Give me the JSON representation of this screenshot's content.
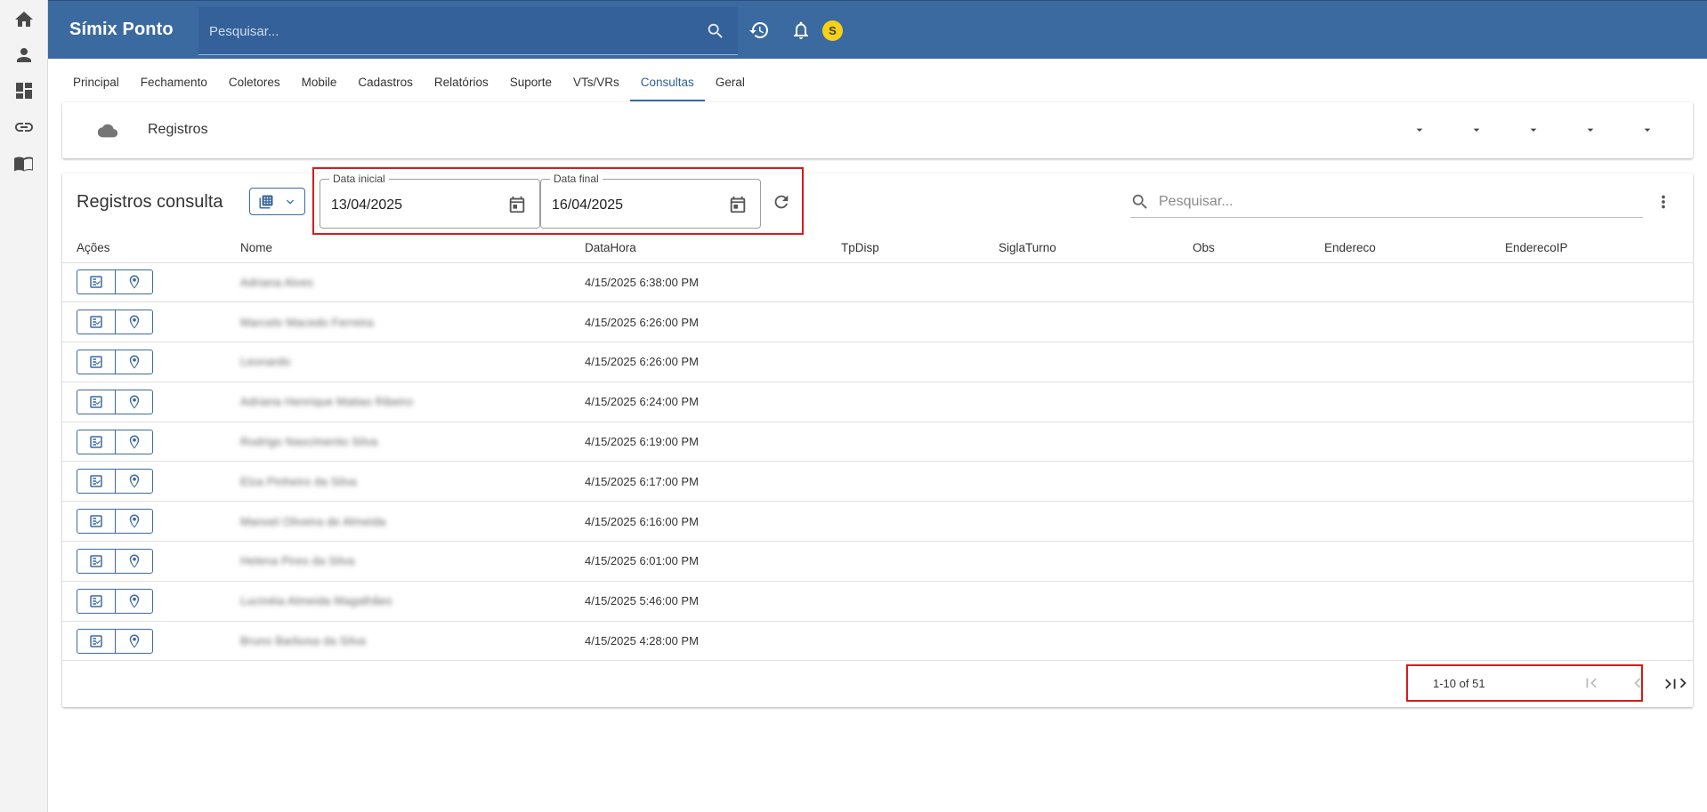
{
  "icons": {
    "rail": [
      "home-icon",
      "person-icon",
      "dashboard-icon",
      "link-icon",
      "book-icon"
    ],
    "bar": [
      "search-icon",
      "history-icon",
      "bell-icon"
    ]
  },
  "colors": {
    "primary": "#3b6aa0",
    "highlight": "#d81b1b",
    "avatar": "#f7d116"
  },
  "appbar": {
    "brand": "Símix Ponto",
    "search_placeholder": "Pesquisar...",
    "avatar_initial": "S"
  },
  "tabs": [
    {
      "label": "Principal"
    },
    {
      "label": "Fechamento"
    },
    {
      "label": "Coletores"
    },
    {
      "label": "Mobile"
    },
    {
      "label": "Cadastros"
    },
    {
      "label": "Relatórios"
    },
    {
      "label": "Suporte"
    },
    {
      "label": "VTs/VRs"
    },
    {
      "label": "Consultas",
      "active": true
    },
    {
      "label": "Geral"
    }
  ],
  "panel": {
    "title": "Registros"
  },
  "main": {
    "title": "Registros consulta",
    "date_start": {
      "label": "Data inicial",
      "value": "13/04/2025"
    },
    "date_end": {
      "label": "Data final",
      "value": "16/04/2025"
    },
    "search_placeholder": "Pesquisar..."
  },
  "table": {
    "columns": [
      "Ações",
      "Nome",
      "DataHora",
      "TpDisp",
      "SiglaTurno",
      "Obs",
      "Endereco",
      "EnderecoIP"
    ],
    "rows": [
      {
        "nome": "Adriana Alves",
        "datahora": "4/15/2025 6:38:00 PM"
      },
      {
        "nome": "Marcelo Macedo Ferreira",
        "datahora": "4/15/2025 6:26:00 PM"
      },
      {
        "nome": "Leonardo",
        "datahora": "4/15/2025 6:26:00 PM"
      },
      {
        "nome": "Adriana Henrique Matias Ribeiro",
        "datahora": "4/15/2025 6:24:00 PM"
      },
      {
        "nome": "Rodrigo Nascimento Silva",
        "datahora": "4/15/2025 6:19:00 PM"
      },
      {
        "nome": "Elza Pinheiro da Silva",
        "datahora": "4/15/2025 6:17:00 PM"
      },
      {
        "nome": "Manoel Oliveira de Almeida",
        "datahora": "4/15/2025 6:16:00 PM"
      },
      {
        "nome": "Helena Pires da Silva",
        "datahora": "4/15/2025 6:01:00 PM"
      },
      {
        "nome": "Lucinéia Almeida Magalhães",
        "datahora": "4/15/2025 5:46:00 PM"
      },
      {
        "nome": "Bruno Barbosa da Silva",
        "datahora": "4/15/2025 4:28:00 PM"
      }
    ]
  },
  "pager": {
    "range": "1-10 of 51"
  }
}
